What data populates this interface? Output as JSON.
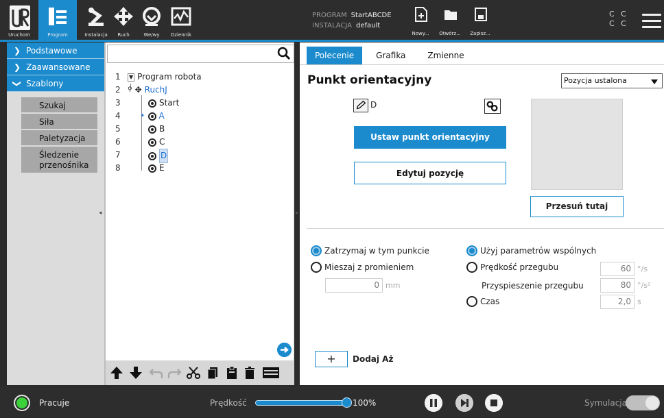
{
  "header": {
    "logo_label": "Uruchom",
    "tabs": [
      {
        "label": "Program",
        "icon": "program-tree-icon",
        "active": true
      },
      {
        "label": "Instalacja",
        "icon": "robot-arm-icon",
        "active": false
      },
      {
        "label": "Ruch",
        "icon": "move-arrows-icon",
        "active": false
      },
      {
        "label": "We/wy",
        "icon": "io-icon",
        "active": false
      },
      {
        "label": "Dziennik",
        "icon": "log-icon",
        "active": false
      }
    ],
    "program_label": "PROGRAM",
    "program_name": "StartABCDE",
    "installation_label": "INSTALACJA",
    "installation_name": "default",
    "file_buttons": [
      {
        "label": "Nowy...",
        "icon": "new-file-icon"
      },
      {
        "label": "Otwórz...",
        "icon": "folder-icon"
      },
      {
        "label": "Zapisz...",
        "icon": "save-icon"
      }
    ],
    "cc_top": "C C",
    "cc_bottom": "C C"
  },
  "sidebar": {
    "categories": [
      {
        "label": "Podstawowe",
        "expanded": false
      },
      {
        "label": "Zaawansowane",
        "expanded": false
      },
      {
        "label": "Szablony",
        "expanded": true
      }
    ],
    "items": [
      {
        "label": "Szukaj"
      },
      {
        "label": "Siła"
      },
      {
        "label": "Paletyzacja"
      },
      {
        "label": "Śledzenie przenośnika"
      }
    ]
  },
  "tree": {
    "search_placeholder": "",
    "rows": [
      {
        "num": "1",
        "label": "Program robota"
      },
      {
        "num": "2",
        "label": "RuchJ"
      },
      {
        "num": "3",
        "label": "Start"
      },
      {
        "num": "4",
        "label": "A"
      },
      {
        "num": "5",
        "label": "B"
      },
      {
        "num": "6",
        "label": "C"
      },
      {
        "num": "7",
        "label": "D"
      },
      {
        "num": "8",
        "label": "E"
      }
    ]
  },
  "panel": {
    "tabs": [
      "Polecenie",
      "Grafika",
      "Zmienne"
    ],
    "title": "Punkt orientacyjny",
    "dropdown_value": "Pozycja ustalona",
    "waypoint_name": "D",
    "set_waypoint_label": "Ustaw punkt orientacyjny",
    "edit_pose_label": "Edytuj pozycję",
    "move_here_label": "Przesuń tutaj",
    "stop_label": "Zatrzymaj w tym punkcie",
    "blend_label": "Mieszaj z promieniem",
    "blend_value": "0",
    "blend_unit": "mm",
    "shared_label": "Użyj parametrów wspólnych",
    "joint_speed_label": "Prędkość przegubu",
    "joint_speed_value": "60",
    "joint_speed_unit": "°/s",
    "joint_accel_label": "Przyspieszenie przegubu",
    "joint_accel_value": "80",
    "joint_accel_unit": "°/s²",
    "time_label": "Czas",
    "time_value": "2,0",
    "time_unit": "s",
    "add_until_plus": "+",
    "add_until_label": "Dodaj Aż"
  },
  "footer": {
    "status": "Pracuje",
    "speed_label": "Prędkość",
    "speed_value": "100%",
    "speed_fraction": 1.0,
    "sim_label": "Symulacja"
  },
  "colors": {
    "accent": "#1b8bce",
    "header_bg": "#2d2d2d",
    "status_ok": "#3bd23b"
  }
}
